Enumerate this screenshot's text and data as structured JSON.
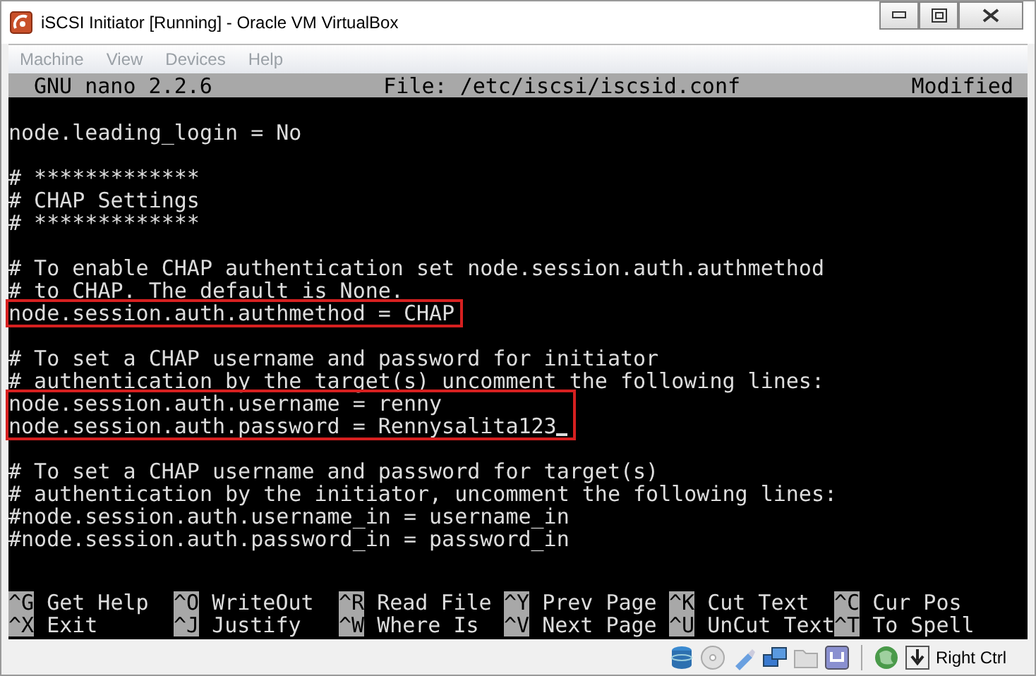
{
  "window": {
    "title": "iSCSI Initiator [Running] - Oracle VM VirtualBox"
  },
  "menu": [
    {
      "label": "Machine",
      "disabled": true
    },
    {
      "label": "View",
      "disabled": true
    },
    {
      "label": "Devices",
      "disabled": true
    },
    {
      "label": "Help",
      "disabled": true
    }
  ],
  "nano": {
    "version": "GNU nano 2.2.6",
    "file": "File: /etc/iscsi/iscsid.conf",
    "status": "Modified"
  },
  "groups": [
    {
      "kind": "text",
      "boxed": false,
      "lines": [
        {
          "text": "node.leading_login = No",
          "cursor": false
        }
      ]
    },
    {
      "kind": "blank"
    },
    {
      "kind": "text",
      "boxed": false,
      "lines": [
        {
          "text": "# *************",
          "cursor": false
        },
        {
          "text": "# CHAP Settings",
          "cursor": false
        },
        {
          "text": "# *************",
          "cursor": false
        }
      ]
    },
    {
      "kind": "blank"
    },
    {
      "kind": "text",
      "boxed": false,
      "lines": [
        {
          "text": "# To enable CHAP authentication set node.session.auth.authmethod",
          "cursor": false
        },
        {
          "text": "# to CHAP. The default is None.",
          "cursor": false
        }
      ]
    },
    {
      "kind": "text",
      "boxed": true,
      "lines": [
        {
          "text": "node.session.auth.authmethod = CHAP",
          "cursor": false
        }
      ]
    },
    {
      "kind": "blank"
    },
    {
      "kind": "text",
      "boxed": false,
      "lines": [
        {
          "text": "# To set a CHAP username and password for initiator",
          "cursor": false
        },
        {
          "text": "# authentication by the target(s) uncomment the following lines:",
          "cursor": false
        }
      ]
    },
    {
      "kind": "text",
      "boxed": true,
      "lines": [
        {
          "text": "node.session.auth.username = renny",
          "cursor": false
        },
        {
          "text": "node.session.auth.password = Rennysalita123",
          "cursor": true
        }
      ]
    },
    {
      "kind": "blank"
    },
    {
      "kind": "text",
      "boxed": false,
      "lines": [
        {
          "text": "# To set a CHAP username and password for target(s)",
          "cursor": false
        },
        {
          "text": "# authentication by the initiator, uncomment the following lines:",
          "cursor": false
        },
        {
          "text": "#node.session.auth.username_in = username_in",
          "cursor": false
        },
        {
          "text": "#node.session.auth.password_in = password_in",
          "cursor": false
        }
      ]
    }
  ],
  "shortcuts": [
    {
      "key": "^G",
      "label": "Get Help"
    },
    {
      "key": "^O",
      "label": "WriteOut"
    },
    {
      "key": "^R",
      "label": "Read File"
    },
    {
      "key": "^Y",
      "label": "Prev Page"
    },
    {
      "key": "^K",
      "label": "Cut Text"
    },
    {
      "key": "^C",
      "label": "Cur Pos"
    },
    {
      "key": "^X",
      "label": "Exit"
    },
    {
      "key": "^J",
      "label": "Justify"
    },
    {
      "key": "^W",
      "label": "Where Is"
    },
    {
      "key": "^V",
      "label": "Next Page"
    },
    {
      "key": "^U",
      "label": "UnCut Text"
    },
    {
      "key": "^T",
      "label": "To Spell"
    }
  ],
  "status_bar": {
    "host_key": "Right Ctrl"
  }
}
